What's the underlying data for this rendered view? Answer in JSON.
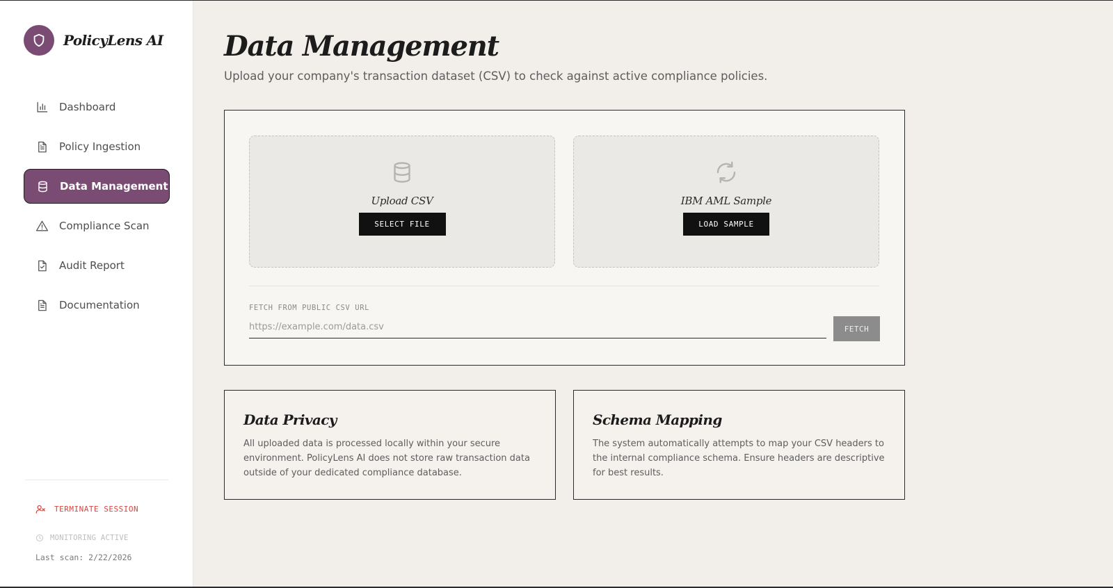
{
  "app": {
    "name": "PolicyLens AI",
    "logo_icon": "shield-icon",
    "accent": "#7a4b73"
  },
  "sidebar": {
    "items": [
      {
        "label": "Dashboard",
        "icon": "bar-chart-icon",
        "active": false
      },
      {
        "label": "Policy Ingestion",
        "icon": "document-icon",
        "active": false
      },
      {
        "label": "Data Management",
        "icon": "database-icon",
        "active": true
      },
      {
        "label": "Compliance Scan",
        "icon": "warning-triangle-icon",
        "active": false
      },
      {
        "label": "Audit Report",
        "icon": "file-check-icon",
        "active": false
      },
      {
        "label": "Documentation",
        "icon": "document-icon",
        "active": false
      }
    ],
    "terminate_label": "TERMINATE SESSION",
    "terminate_color": "#d9443f",
    "monitoring_label": "MONITORING ACTIVE",
    "last_scan": "Last scan: 2/22/2026"
  },
  "main": {
    "title": "Data Management",
    "subtitle": "Upload your company's transaction dataset (CSV) to check against active compliance policies.",
    "upload": {
      "title": "Upload CSV",
      "button": "SELECT FILE",
      "icon": "database-icon"
    },
    "sample": {
      "title": "IBM AML Sample",
      "button": "LOAD SAMPLE",
      "icon": "refresh-icon"
    },
    "fetch": {
      "label": "FETCH FROM PUBLIC CSV URL",
      "placeholder": "https://example.com/data.csv",
      "button": "FETCH"
    },
    "privacy": {
      "title": "Data Privacy",
      "text": "All uploaded data is processed locally within your secure environment. PolicyLens AI does not store raw transaction data outside of your dedicated compliance database."
    },
    "schema": {
      "title": "Schema Mapping",
      "text": "The system automatically attempts to map your CSV headers to the internal compliance schema. Ensure headers are descriptive for best results."
    }
  }
}
